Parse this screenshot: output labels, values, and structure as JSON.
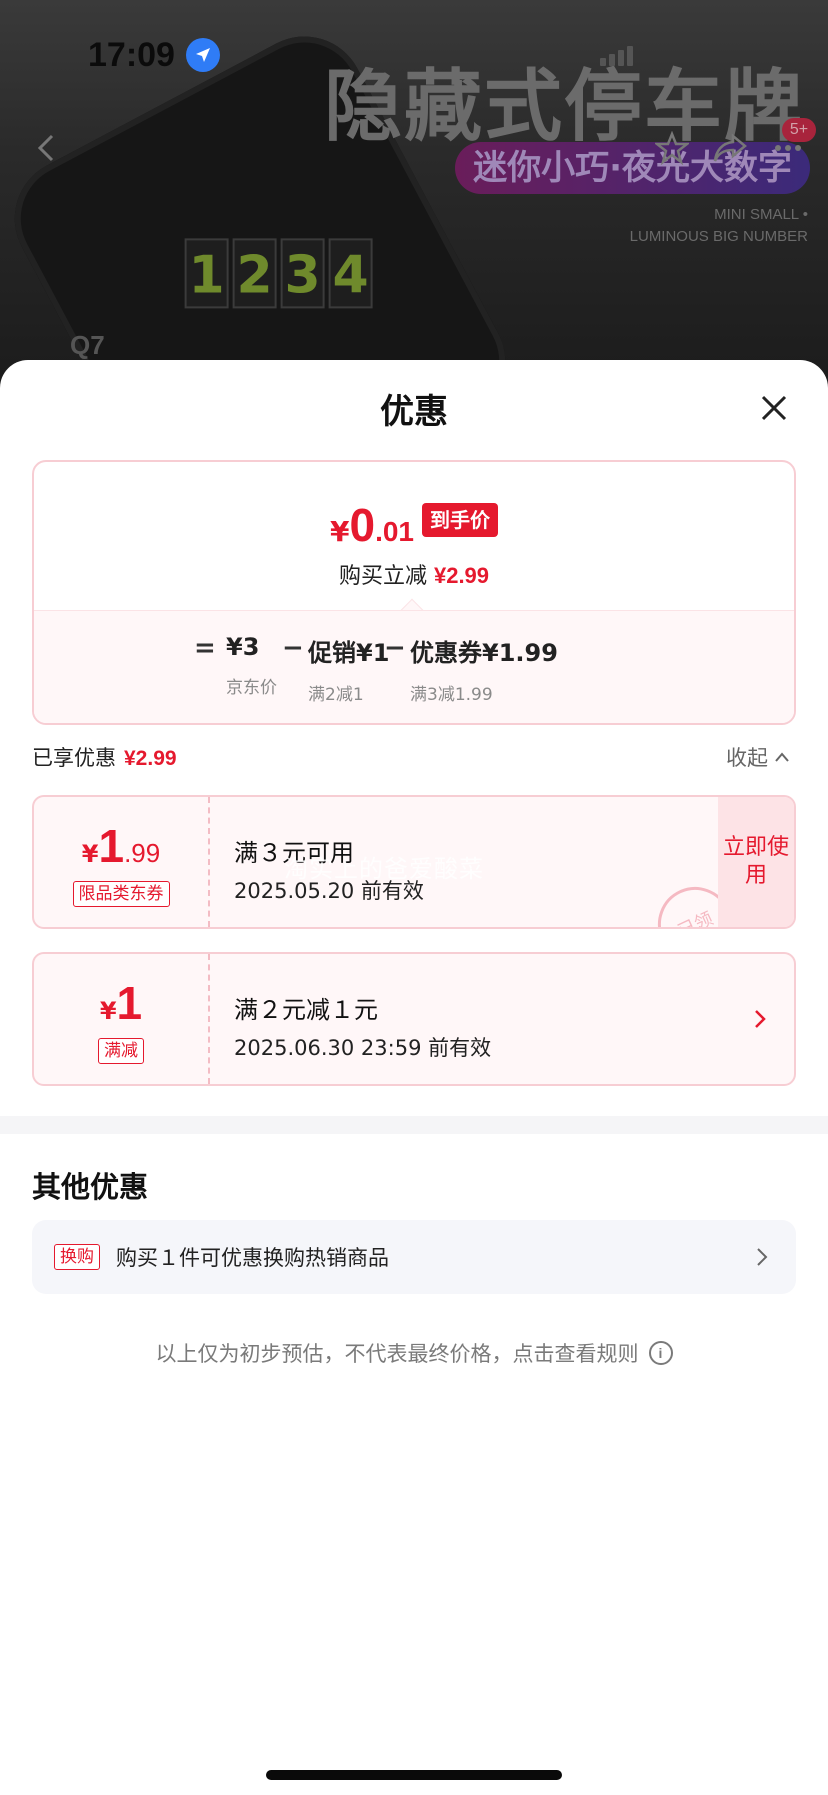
{
  "status_bar": {
    "time": "17:09"
  },
  "background": {
    "headline": "隐藏式停车牌",
    "subheadline": "迷你小巧·夜光大数字",
    "english_line1": "MINI SMALL •",
    "english_line2": "LUMINOUS BIG NUMBER",
    "digits": [
      "1",
      "2",
      "3",
      "4"
    ],
    "model": "Q7",
    "badge": "5+"
  },
  "sheet": {
    "title": "优惠",
    "summary": {
      "currency": "¥",
      "price_int": "0",
      "price_dec": ".01",
      "price_tag": "到手价",
      "reduce_label": "购买立减",
      "reduce_value": "¥2.99",
      "formula": [
        {
          "op": "=",
          "main": "¥3",
          "sub": "京东价"
        },
        {
          "op": "−",
          "main": "促销¥1",
          "sub": "满2减1"
        },
        {
          "op": "−",
          "main": "优惠券¥1.99",
          "sub": "满3减1.99"
        }
      ]
    },
    "enjoyed": {
      "label": "已享优惠",
      "value": "¥2.99",
      "collapse_label": "收起"
    },
    "coupons": [
      {
        "yen": "¥",
        "int": "1",
        "dec": ".99",
        "tag": "限品类东券",
        "title": "满３元可用",
        "date": "2025.05.20 前有效",
        "action": "立即使用",
        "stamp": "已领",
        "watermark": "淘实上的爸爱酸菜"
      },
      {
        "yen": "¥",
        "int": "1",
        "dec": "",
        "tag": "满减",
        "title": "满２元减１元",
        "date": "2025.06.30 23:59 前有效"
      }
    ],
    "other": {
      "title": "其他优惠",
      "item_tag": "换购",
      "item_text": "购买１件可优惠换购热销商品"
    },
    "disclaimer": "以上仅为初步预估，不代表最终价格，点击查看规则"
  }
}
